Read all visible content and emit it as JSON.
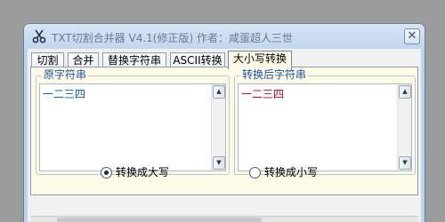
{
  "window": {
    "title": "TXT切割合并器 V4.1(修正版) 作者：咸蛋超人三世",
    "close_glyph": "✕"
  },
  "tabs": [
    {
      "label": "切割"
    },
    {
      "label": "合并"
    },
    {
      "label": "替换字符串"
    },
    {
      "label": "ASCII转换"
    },
    {
      "label": "大小写转换",
      "active": true
    }
  ],
  "original": {
    "label": "原字符串",
    "text": "一二三四",
    "text_color": "#0a5cb8"
  },
  "converted": {
    "label": "转换后字符串",
    "text": "一二三四",
    "text_color": "#d0021b"
  },
  "options": {
    "to_upper": {
      "label": "转换成大写",
      "checked": true
    },
    "to_lower": {
      "label": "转换成小写",
      "checked": false
    }
  },
  "scroll": {
    "up_glyph": "▲",
    "down_glyph": "▼"
  },
  "icons": {
    "app": "scissors-icon",
    "close": "close-icon"
  }
}
